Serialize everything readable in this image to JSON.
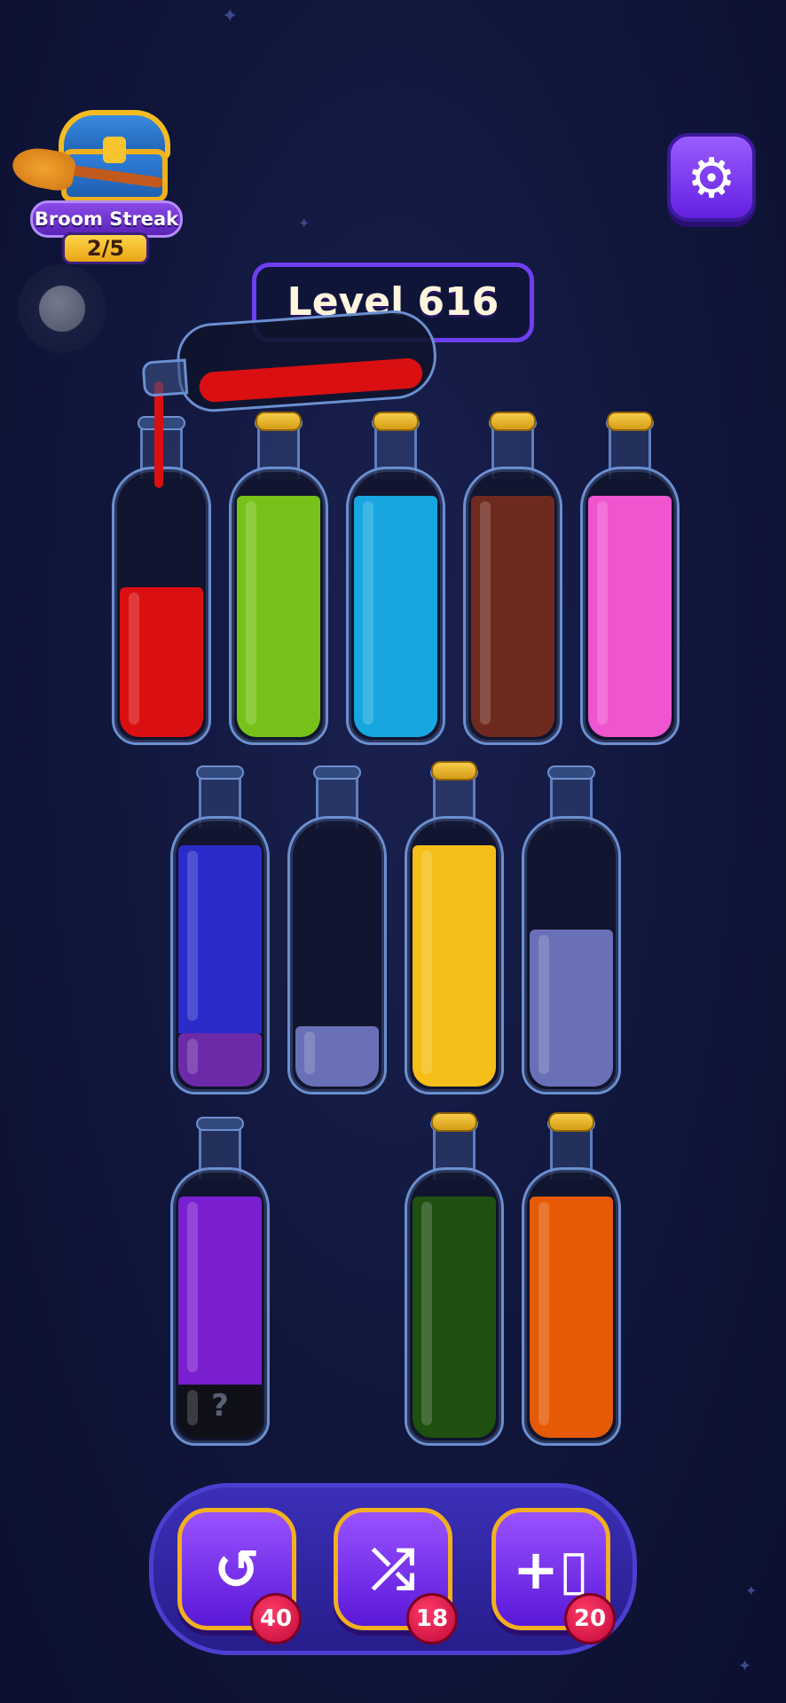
{
  "streak": {
    "title": "Broom Streak",
    "count": "2/5"
  },
  "level": {
    "label": "Level 616"
  },
  "settings": {
    "icon": "gear-icon"
  },
  "bottles": [
    {
      "colors": [
        "#d90f12"
      ],
      "fill": 0.62,
      "cork": false,
      "pouring_target": true
    },
    {
      "colors": [
        "#76c21a"
      ],
      "fill": 1.0,
      "cork": true
    },
    {
      "colors": [
        "#17a6e0"
      ],
      "fill": 1.0,
      "cork": true
    },
    {
      "colors": [
        "#6e2a1e"
      ],
      "fill": 1.0,
      "cork": true
    },
    {
      "colors": [
        "#ee55cf"
      ],
      "fill": 1.0,
      "cork": true
    },
    {
      "colors": [
        "#6d2aa8",
        "#2a2bc8"
      ],
      "fill": 1.0,
      "cork": false
    },
    {
      "colors": [
        "#6a70b8"
      ],
      "fill": 0.25,
      "cork": false
    },
    {
      "colors": [
        "#f6be18"
      ],
      "fill": 1.0,
      "cork": true
    },
    {
      "colors": [
        "#6a70b8"
      ],
      "fill": 0.65,
      "cork": false
    },
    {
      "colors": [
        "#101018",
        "#7a1fd0"
      ],
      "fill": 1.0,
      "cork": false,
      "hidden_label": "?"
    },
    {
      "colors": [
        "#1f5010"
      ],
      "fill": 1.0,
      "cork": true
    },
    {
      "colors": [
        "#e65a05"
      ],
      "fill": 1.0,
      "cork": true
    }
  ],
  "pouring_bottle": {
    "color": "#d90f12"
  },
  "tools": [
    {
      "icon": "undo-icon",
      "glyph": "↺",
      "count": "40"
    },
    {
      "icon": "shuffle-icon",
      "glyph": "⤮",
      "count": "18"
    },
    {
      "icon": "add-bottle-icon",
      "glyph": "+▯",
      "count": "20"
    }
  ]
}
